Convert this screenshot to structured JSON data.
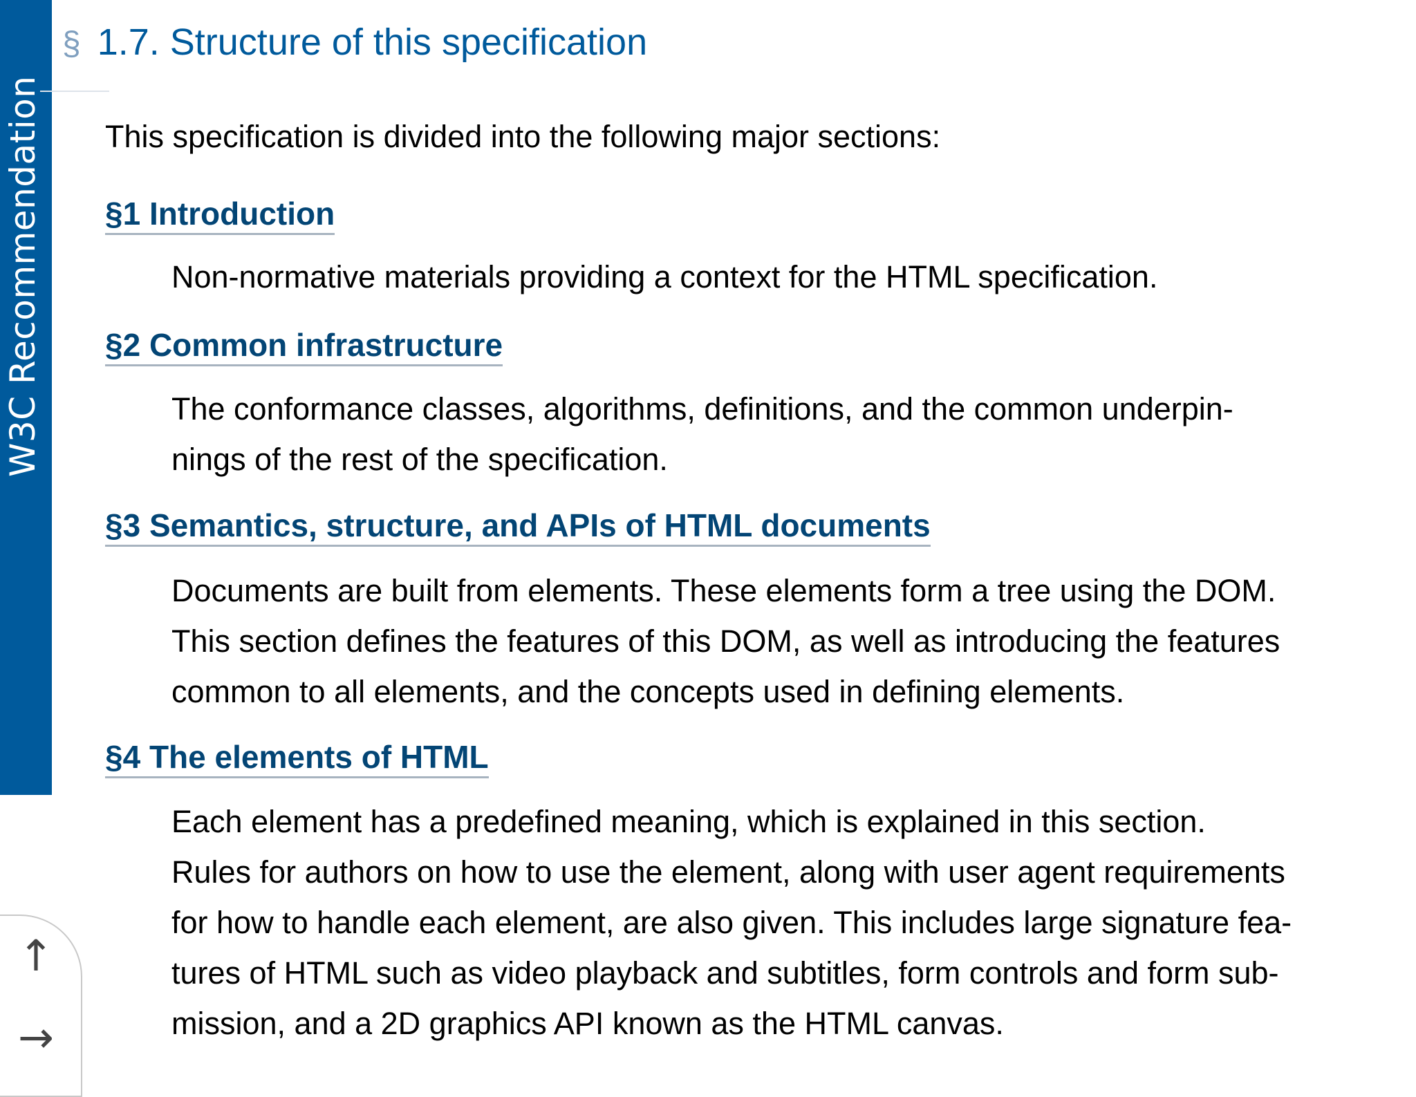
{
  "sidebar": {
    "label": "W3C Recommendation"
  },
  "section": {
    "selflink": "§",
    "title": "1.7. Structure of this specification",
    "intro": "This specification is divided into the following major sections:"
  },
  "items": [
    {
      "term": "§1 Introduction",
      "lines": [
        "Non-normative materials providing a context for the HTML specification."
      ]
    },
    {
      "term": "§2 Common infrastructure",
      "lines": [
        "The conformance classes, algorithms, definitions, and the common underpin-",
        "nings of the rest of the specification."
      ]
    },
    {
      "term": "§3 Semantics, structure, and APIs of HTML documents",
      "lines": [
        "Documents are built from elements. These elements form a tree using the DOM.",
        "This section defines the features of this DOM, as well as introducing the features",
        "common to all elements, and the concepts used in defining elements."
      ]
    },
    {
      "term": "§4 The elements of HTML",
      "lines": [
        "Each element has a predefined meaning, which is explained in this section.",
        "Rules for authors on how to use the element, along with user agent requirements",
        "for how to handle each element, are also given. This includes large signature fea-",
        "tures of HTML such as video playback and subtitles, form controls and form sub-",
        "mission, and a 2D graphics API known as the HTML canvas."
      ]
    }
  ],
  "nav": {
    "up_icon": "up-arrow-icon",
    "next_icon": "right-arrow-icon",
    "up_glyph": "↑",
    "next_glyph": "→"
  },
  "colors": {
    "sidebar": "#005a9c",
    "heading": "#005a9c",
    "link": "#034575"
  }
}
